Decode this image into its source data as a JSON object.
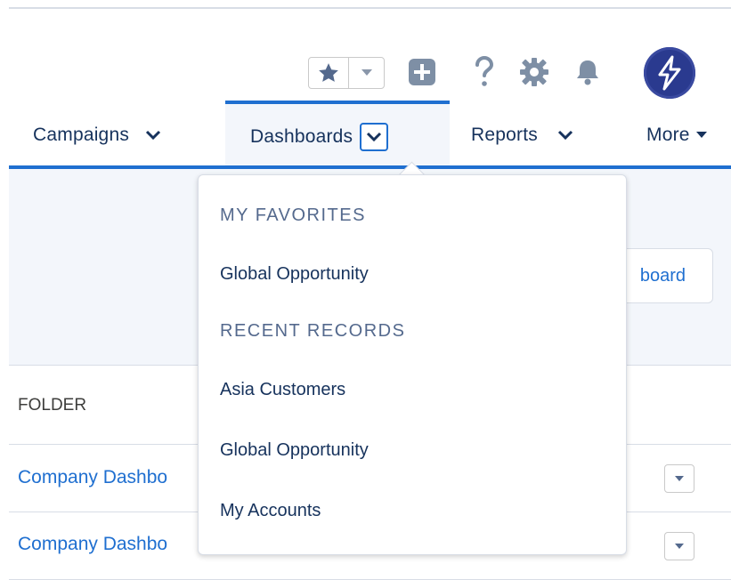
{
  "header": {
    "icons": [
      "star-icon",
      "chevron-down-icon",
      "plus-icon",
      "help-icon",
      "gear-icon",
      "bell-icon",
      "lightning-avatar-icon"
    ]
  },
  "nav": {
    "tabs": [
      {
        "label": "Campaigns"
      },
      {
        "label": "Dashboards"
      },
      {
        "label": "Reports"
      },
      {
        "label": "More"
      }
    ]
  },
  "page": {
    "new_button_partial": "board",
    "table": {
      "folder_header": "FOLDER",
      "rows": [
        {
          "name": "Company Dashbo"
        },
        {
          "name": "Company Dashbo"
        }
      ]
    }
  },
  "dropdown": {
    "favorites_heading": "MY FAVORITES",
    "favorites": [
      "Global Opportunity"
    ],
    "recent_heading": "RECENT RECORDS",
    "recent": [
      "Asia Customers",
      "Global Opportunity",
      "My Accounts"
    ]
  },
  "colors": {
    "brand_blue": "#1f6fd0",
    "text_dark": "#16325c",
    "avatar_bg": "#2a3a8f"
  }
}
